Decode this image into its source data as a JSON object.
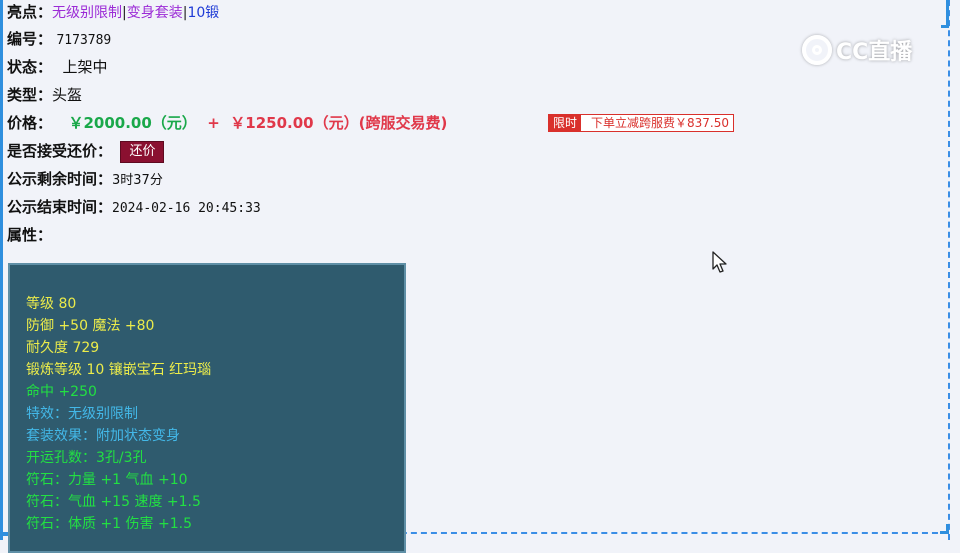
{
  "highlight": {
    "label": "亮点：",
    "items": [
      "无级别限制",
      "变身套装",
      "10锻"
    ],
    "separator": "|"
  },
  "item_id": {
    "label": "编号：",
    "value": "7173789"
  },
  "status": {
    "label": "状态：",
    "value": "上架中"
  },
  "category": {
    "label": "类型：",
    "value": "头盔"
  },
  "price": {
    "label": "价格：",
    "main": "￥2000.00（元）",
    "plus": "+",
    "transfer": "￥1250.00（元）(跨服交易费)",
    "badge_tag": "限时",
    "badge_note": "下单立减跨服费￥837.50"
  },
  "counter_offer": {
    "label": "是否接受还价：",
    "button": "还价"
  },
  "time_left": {
    "label": "公示剩余时间：",
    "value": "3时37分"
  },
  "end_time": {
    "label": "公示结束时间：",
    "value": "2024-02-16 20:45:33"
  },
  "attributes": {
    "label": "属性：",
    "lines": [
      "等级 80",
      "防御 +50 魔法 +80",
      "耐久度 729",
      "锻炼等级 10 镶嵌宝石 红玛瑙",
      "命中 +250",
      "特效：无级别限制",
      "套装效果：附加状态变身",
      "开运孔数：3孔/3孔",
      "符石：力量 +1 气血 +10",
      "符石：气血 +15 速度 +1.5",
      "符石：体质 +1 伤害 +1.5"
    ]
  },
  "watermark": {
    "text": "CC直播",
    "icon": "cc-logo-icon"
  },
  "colors": {
    "highlight": "#9b2bd6",
    "link": "#1f3bd6",
    "price": "#1aa84a",
    "transfer_fee": "#e0384a",
    "badge": "#d9302c",
    "counter_button": "#8a1030",
    "panel_bg": "#2f5b6e",
    "attr_yellow": "#ecec4a",
    "attr_cyan": "#43b8e8",
    "attr_green": "#22e042"
  }
}
